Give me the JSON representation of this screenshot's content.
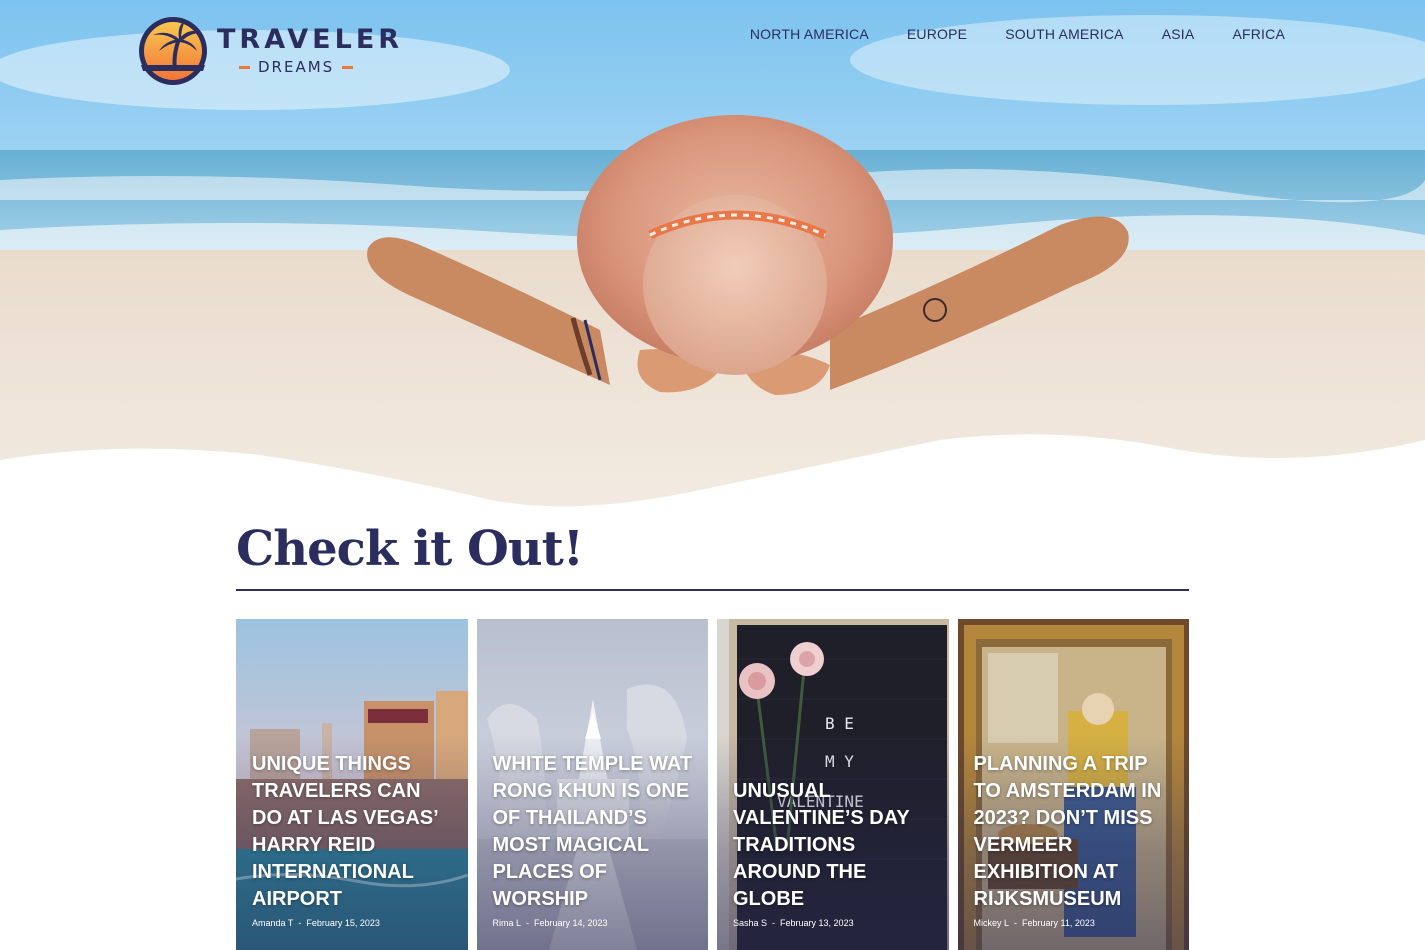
{
  "brand": {
    "name": "TRAVELER",
    "tagline": "DREAMS",
    "colors": {
      "navy": "#2b2d5e",
      "orange": "#f2763a",
      "yellow": "#f9c74f"
    }
  },
  "nav": {
    "items": [
      {
        "label": "NORTH AMERICA"
      },
      {
        "label": "EUROPE"
      },
      {
        "label": "SOUTH AMERICA"
      },
      {
        "label": "ASIA"
      },
      {
        "label": "AFRICA"
      }
    ]
  },
  "hero": {
    "image": "beach-hat-woman-image"
  },
  "section": {
    "title": "Check it Out!"
  },
  "cards": [
    {
      "title": "Unique Things Travelers Can Do at Las Vegas’ Harry Reid International Airport",
      "author": "Amanda T",
      "separator": "-",
      "date": "February 15, 2023",
      "image": "las-vegas-image"
    },
    {
      "title": "White Temple Wat Rong Khun is One of Thailand’s Most Magical Places of Worship",
      "author": "Rima L",
      "separator": "-",
      "date": "February 14, 2023",
      "image": "white-temple-image"
    },
    {
      "title": "Unusual Valentine’s Day Traditions Around the Globe",
      "author": "Sasha S",
      "separator": "-",
      "date": "February 13, 2023",
      "image": "valentine-letterboard-image"
    },
    {
      "title": "Planning a Trip to Amsterdam in 2023? Don’t Miss Vermeer Exhibition at Rijksmuseum",
      "author": "Mickey L",
      "separator": "-",
      "date": "February 11, 2023",
      "image": "vermeer-painting-image"
    }
  ]
}
